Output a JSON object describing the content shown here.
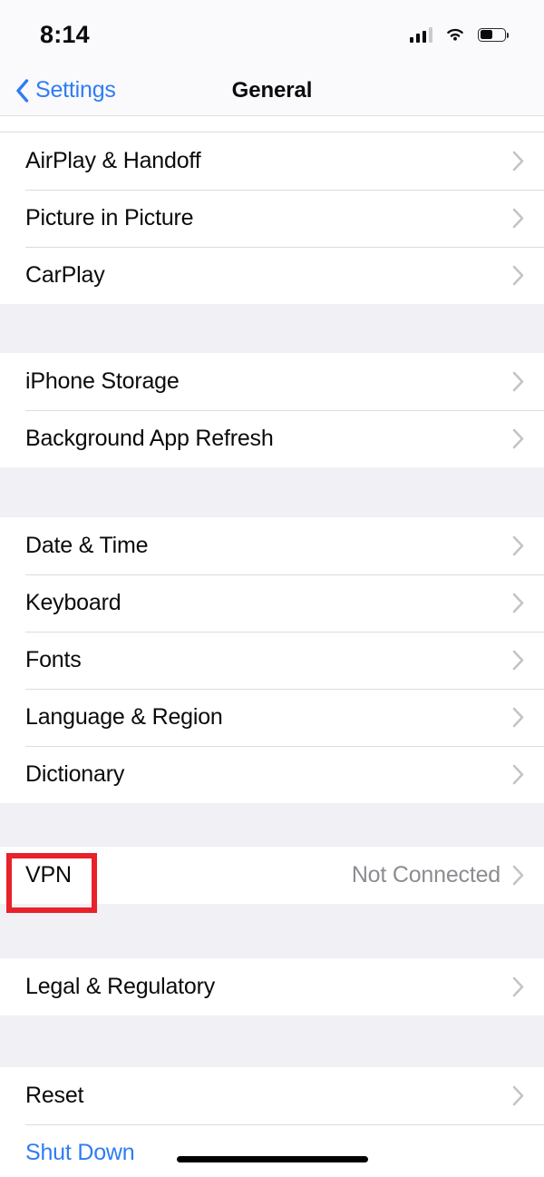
{
  "status_bar": {
    "time": "8:14",
    "cellular_icon": "cellular-signal-icon",
    "wifi_icon": "wifi-icon",
    "battery_icon": "battery-icon",
    "battery_level_percent": 50
  },
  "nav": {
    "back_label": "Settings",
    "back_icon": "chevron-left-icon",
    "title": "General"
  },
  "colors": {
    "tint_blue": "#2f7cf6",
    "group_background": "#f0f0f5",
    "row_background": "#ffffff",
    "separator": "#dcdce0",
    "secondary_text": "#8c8c91",
    "chevron": "#c4c4c8",
    "highlight_box": "#e8212b"
  },
  "highlight": {
    "target": "VPN",
    "color": "#e8212b"
  },
  "groups": [
    {
      "name": "media-group",
      "rows": [
        {
          "label": "AirPlay & Handoff",
          "value": "",
          "accessory": "chevron-right-icon",
          "tint": false
        },
        {
          "label": "Picture in Picture",
          "value": "",
          "accessory": "chevron-right-icon",
          "tint": false
        },
        {
          "label": "CarPlay",
          "value": "",
          "accessory": "chevron-right-icon",
          "tint": false
        }
      ]
    },
    {
      "name": "storage-group",
      "rows": [
        {
          "label": "iPhone Storage",
          "value": "",
          "accessory": "chevron-right-icon",
          "tint": false
        },
        {
          "label": "Background App Refresh",
          "value": "",
          "accessory": "chevron-right-icon",
          "tint": false
        }
      ]
    },
    {
      "name": "localization-group",
      "rows": [
        {
          "label": "Date & Time",
          "value": "",
          "accessory": "chevron-right-icon",
          "tint": false
        },
        {
          "label": "Keyboard",
          "value": "",
          "accessory": "chevron-right-icon",
          "tint": false
        },
        {
          "label": "Fonts",
          "value": "",
          "accessory": "chevron-right-icon",
          "tint": false
        },
        {
          "label": "Language & Region",
          "value": "",
          "accessory": "chevron-right-icon",
          "tint": false
        },
        {
          "label": "Dictionary",
          "value": "",
          "accessory": "chevron-right-icon",
          "tint": false
        }
      ]
    },
    {
      "name": "vpn-group",
      "rows": [
        {
          "label": "VPN",
          "value": "Not Connected",
          "accessory": "chevron-right-icon",
          "tint": false
        }
      ]
    },
    {
      "name": "legal-group",
      "rows": [
        {
          "label": "Legal & Regulatory",
          "value": "",
          "accessory": "chevron-right-icon",
          "tint": false
        }
      ]
    },
    {
      "name": "system-group",
      "rows": [
        {
          "label": "Reset",
          "value": "",
          "accessory": "chevron-right-icon",
          "tint": false
        },
        {
          "label": "Shut Down",
          "value": "",
          "accessory": "",
          "tint": true
        }
      ]
    }
  ],
  "home_indicator": "home-indicator"
}
